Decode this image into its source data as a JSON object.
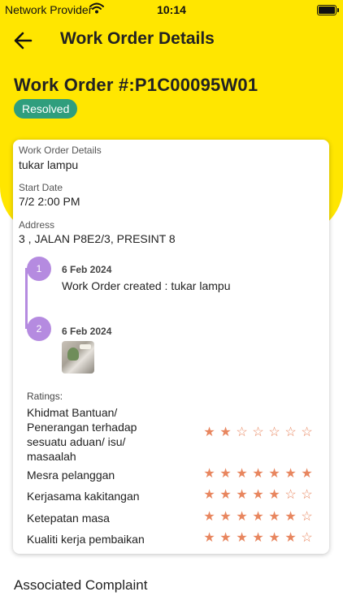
{
  "status_bar": {
    "carrier": "Network Provider",
    "time": "10:14"
  },
  "header": {
    "title": "Work Order Details"
  },
  "work_order": {
    "number": "Work Order #:P1C00095W01",
    "status": "Resolved"
  },
  "details": {
    "details_label": "Work Order Details",
    "details_value": "tukar lampu",
    "start_label": "Start Date",
    "start_value": "7/2 2:00 PM",
    "address_label": "Address",
    "address_value": "3 , JALAN P8E2/3, PRESINT 8"
  },
  "timeline": [
    {
      "step": "1",
      "date": "6 Feb 2024",
      "text": "Work Order created : tukar lampu"
    },
    {
      "step": "2",
      "date": "6 Feb 2024",
      "text": ""
    }
  ],
  "ratings": {
    "title": "Ratings:",
    "items": [
      {
        "label": "Khidmat Bantuan/ Penerangan terhadap sesuatu aduan/ isu/ masaalah",
        "value": 2,
        "max": 7
      },
      {
        "label": "Mesra pelanggan",
        "value": 7,
        "max": 7
      },
      {
        "label": "Kerjasama kakitangan",
        "value": 5,
        "max": 7
      },
      {
        "label": "Ketepatan masa",
        "value": 6,
        "max": 7
      },
      {
        "label": "Kualiti kerja pembaikan",
        "value": 6,
        "max": 7
      }
    ]
  },
  "associated": {
    "title": "Associated Complaint"
  },
  "colors": {
    "header_bg": "#ffe600",
    "badge": "#2f9e7d",
    "timeline": "#b58be0",
    "star": "#e8865f"
  }
}
